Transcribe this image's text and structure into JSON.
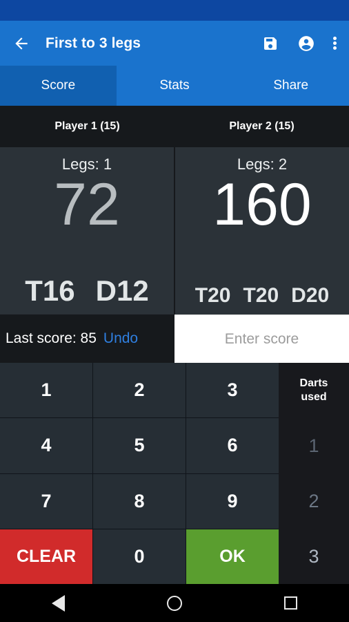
{
  "appbar": {
    "title": "First to 3 legs",
    "back_icon": "arrow-back-icon",
    "save_icon": "save-floppy-icon",
    "account_icon": "account-circle-icon",
    "overflow_icon": "more-vert-icon"
  },
  "tabs": [
    {
      "label": "Score",
      "active": true
    },
    {
      "label": "Stats",
      "active": false
    },
    {
      "label": "Share",
      "active": false
    }
  ],
  "players": [
    {
      "header": "Player 1 (15)",
      "legs_label": "Legs: 1",
      "score": "72",
      "active": false,
      "throws": [
        "T16",
        "D12"
      ]
    },
    {
      "header": "Player 2 (15)",
      "legs_label": "Legs: 2",
      "score": "160",
      "active": true,
      "throws": [
        "T20",
        "T20",
        "D20"
      ]
    }
  ],
  "lastbar": {
    "last_score_text": "Last score: 85",
    "undo_label": "Undo",
    "input_value": "",
    "input_placeholder": "Enter score"
  },
  "keypad": {
    "keys": [
      "1",
      "2",
      "3",
      "4",
      "5",
      "6",
      "7",
      "8",
      "9"
    ],
    "clear_label": "CLEAR",
    "zero_label": "0",
    "ok_label": "OK"
  },
  "darts_used": {
    "header_line1": "Darts",
    "header_line2": "used",
    "values": [
      "1",
      "2",
      "3"
    ]
  },
  "navbar": {
    "back_icon": "nav-back-triangle-icon",
    "home_icon": "nav-home-circle-icon",
    "recents_icon": "nav-recents-square-icon"
  },
  "colors": {
    "status_bar": "#0d47a1",
    "app_bar": "#1a73cd",
    "tab_active": "#1160b0",
    "panel_bg": "#2b3238",
    "header_bg": "#16191c",
    "key_bg": "#262e35",
    "clear": "#d12b2b",
    "ok": "#5a9e2f",
    "undo_link": "#2f7fe0",
    "darts_col_bg": "#18191d"
  }
}
